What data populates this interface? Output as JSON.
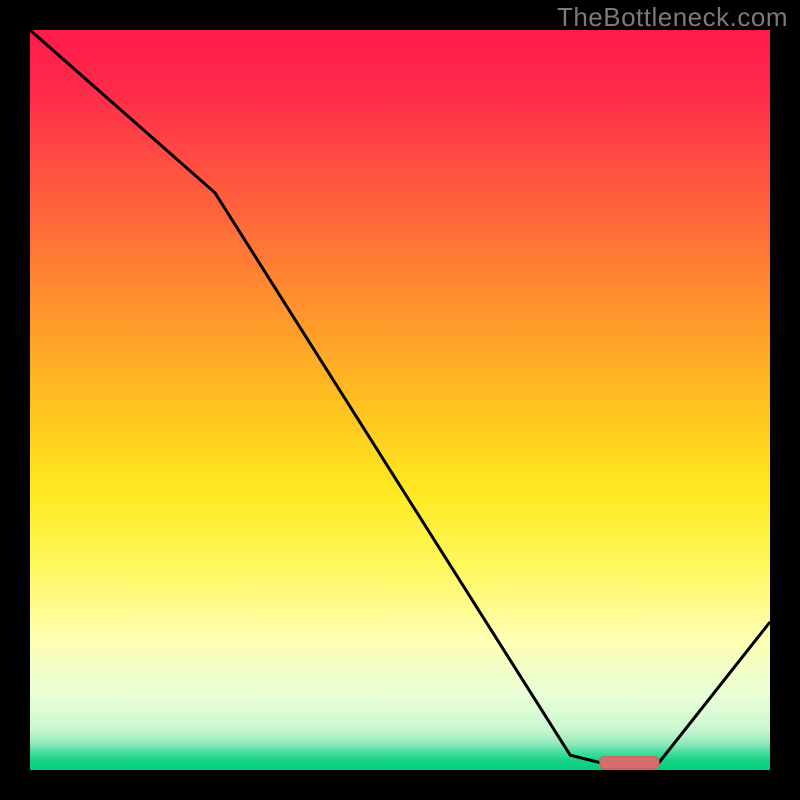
{
  "watermark": "TheBottleneck.com",
  "colors": {
    "black": "#000000",
    "watermark": "#7a7a7a",
    "line": "#000000",
    "marker_fill": "#d66e6e",
    "marker_stroke": "#c95f5f",
    "gradient_stops": [
      {
        "offset": 0.0,
        "color": "#ff1a4b"
      },
      {
        "offset": 0.08,
        "color": "#ff2a4a"
      },
      {
        "offset": 0.2,
        "color": "#ff5540"
      },
      {
        "offset": 0.35,
        "color": "#ff8a30"
      },
      {
        "offset": 0.5,
        "color": "#ffbf20"
      },
      {
        "offset": 0.62,
        "color": "#ffe820"
      },
      {
        "offset": 0.72,
        "color": "#fff75a"
      },
      {
        "offset": 0.82,
        "color": "#ffffb0"
      },
      {
        "offset": 0.9,
        "color": "#e8ffd8"
      },
      {
        "offset": 0.945,
        "color": "#caf7cf"
      },
      {
        "offset": 0.965,
        "color": "#8ce9b8"
      },
      {
        "offset": 0.975,
        "color": "#4edea0"
      },
      {
        "offset": 0.985,
        "color": "#1dd589"
      },
      {
        "offset": 1.0,
        "color": "#00d07c"
      }
    ]
  },
  "chart_data": {
    "type": "line",
    "title": "",
    "xlabel": "",
    "ylabel": "",
    "xlim": [
      0,
      100
    ],
    "ylim": [
      0,
      100
    ],
    "x": [
      0,
      25,
      73,
      77,
      85,
      100
    ],
    "values": [
      100,
      78,
      2,
      1,
      1,
      20
    ],
    "marker": {
      "x_start": 77,
      "x_end": 85,
      "y": 1
    },
    "annotations": []
  }
}
